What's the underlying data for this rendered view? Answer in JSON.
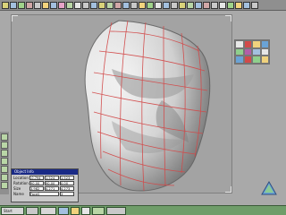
{
  "window": {
    "title": ""
  },
  "object_info": {
    "title": "Object Info",
    "rows": [
      {
        "label": "Location",
        "x": "-0.794",
        "y": "1.524",
        "z": "1.523"
      },
      {
        "label": "Rotation",
        "x": "90.00",
        "y": "90.00",
        "z": "0.00"
      },
      {
        "label": "Size",
        "x": "3.982",
        "y": "4.271",
        "z": "4.273"
      }
    ],
    "name_label": "Name",
    "name_value": "Face0",
    "extra_value": "3"
  },
  "taskbar": {
    "start_label": "Start"
  },
  "colors": {
    "taskbar": "#6f9d69",
    "viewport": "#a3a3a3",
    "mesh_lines": "#d24a4a"
  }
}
